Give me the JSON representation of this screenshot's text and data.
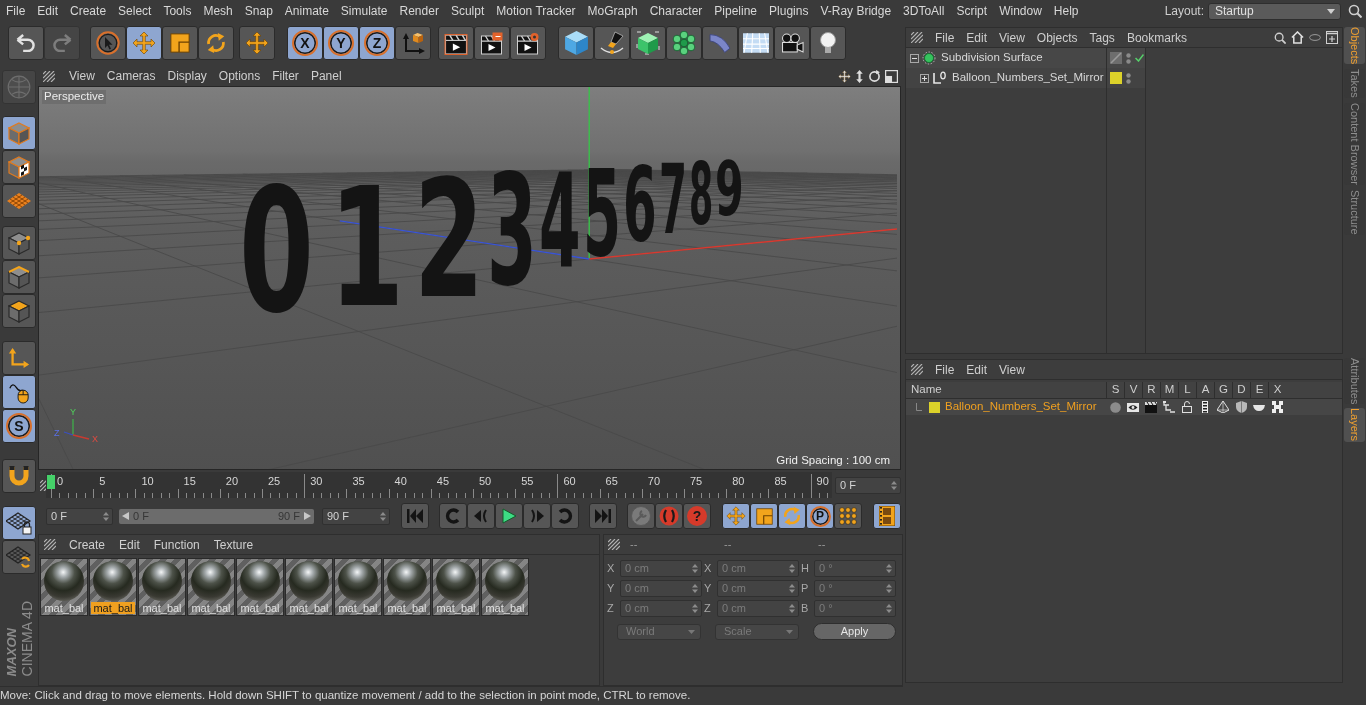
{
  "menu": [
    "File",
    "Edit",
    "Create",
    "Select",
    "Tools",
    "Mesh",
    "Snap",
    "Animate",
    "Simulate",
    "Render",
    "Sculpt",
    "Motion Tracker",
    "MoGraph",
    "Character",
    "Pipeline",
    "Plugins",
    "V-Ray Bridge",
    "3DToAll",
    "Script",
    "Window",
    "Help"
  ],
  "layout": {
    "label": "Layout:",
    "value": "Startup"
  },
  "toolbar": {
    "history": [
      {
        "disabled": false
      },
      {
        "disabled": true
      }
    ],
    "tools": [
      {
        "selected": false
      },
      {
        "selected": true
      },
      {
        "selected": false
      },
      {
        "selected": false
      }
    ],
    "axis_locks": [
      {
        "label": "X",
        "selected": true
      },
      {
        "label": "Y",
        "selected": true
      },
      {
        "label": "Z",
        "selected": true
      }
    ],
    "coordinate_system": {
      "selected": false
    }
  },
  "left_toolbar": {
    "top": {
      "disabled": true
    },
    "modes": [
      {
        "selected": true
      },
      {
        "selected": false
      },
      {
        "selected": false
      }
    ],
    "components": [
      {
        "selected": false
      },
      {
        "selected": false
      },
      {
        "selected": false
      }
    ],
    "tools": [
      {
        "selected": false
      },
      {
        "selected": true
      },
      {
        "label": "S",
        "selected": true
      }
    ],
    "workplane": [
      {
        "selected": true
      },
      {
        "selected": false
      }
    ]
  },
  "logo": {
    "brand": "MAXON",
    "product": "CINEMA 4D"
  },
  "viewport": {
    "menu": [
      "View",
      "Cameras",
      "Display",
      "Options",
      "Filter",
      "Panel"
    ],
    "camera": "Perspective",
    "model_digits": [
      "0",
      "1",
      "2",
      "3",
      "4",
      "5",
      "6",
      "7",
      "8",
      "9"
    ],
    "axis_labels": [
      "Y",
      "Z",
      "X"
    ],
    "grid_spacing": "Grid Spacing : 100 cm"
  },
  "timeline": {
    "ticks": [
      "0",
      "5",
      "10",
      "15",
      "20",
      "25",
      "30",
      "35",
      "40",
      "45",
      "50",
      "55",
      "60",
      "65",
      "70",
      "75",
      "80",
      "85",
      "90"
    ],
    "level": 0,
    "current_frame": "0 F"
  },
  "transport": {
    "start": "0 F",
    "range": {
      "start": "0 F",
      "end": "90 F",
      "level": 1
    },
    "end": "90 F",
    "help_label": "?",
    "key_filters": [
      {
        "selected": true
      },
      {
        "selected": true
      },
      {
        "selected": true
      },
      {
        "label": "P",
        "selected": true
      },
      {
        "selected": false
      }
    ],
    "timeline_button": {
      "selected": true
    }
  },
  "materials": {
    "menu": [
      "Create",
      "Edit",
      "Function",
      "Texture"
    ],
    "items": [
      {
        "name": "mat_bal",
        "selected": false
      },
      {
        "name": "mat_bal",
        "selected": true
      },
      {
        "name": "mat_bal",
        "selected": false
      },
      {
        "name": "mat_bal",
        "selected": false
      },
      {
        "name": "mat_bal",
        "selected": false
      },
      {
        "name": "mat_bal",
        "selected": false
      },
      {
        "name": "mat_bal",
        "selected": false
      },
      {
        "name": "mat_bal",
        "selected": false
      },
      {
        "name": "mat_bal",
        "selected": false
      },
      {
        "name": "mat_bal",
        "selected": false
      }
    ]
  },
  "coordinates": {
    "headers": [
      "--",
      "--",
      "--"
    ],
    "disabled": true,
    "rows": [
      [
        {
          "axis": "X",
          "value": "0 cm"
        },
        {
          "axis": "X",
          "value": "0 cm"
        },
        {
          "axis": "H",
          "value": "0 °"
        }
      ],
      [
        {
          "axis": "Y",
          "value": "0 cm"
        },
        {
          "axis": "Y",
          "value": "0 cm"
        },
        {
          "axis": "P",
          "value": "0 °"
        }
      ],
      [
        {
          "axis": "Z",
          "value": "0 cm"
        },
        {
          "axis": "Z",
          "value": "0 cm"
        },
        {
          "axis": "B",
          "value": "0 °"
        }
      ]
    ],
    "dropdowns": [
      "World",
      "Scale"
    ],
    "apply": "Apply"
  },
  "status_bar": "Move: Click and drag to move elements. Hold down SHIFT to quantize movement / add to the selection in point mode, CTRL to remove.",
  "objects": {
    "menu": [
      "File",
      "Edit",
      "View",
      "Objects",
      "Tags",
      "Bookmarks"
    ],
    "tree": [
      {
        "name": "Subdivision Surface",
        "kind": "subdivision",
        "expanded": true,
        "enabled": true,
        "children": [
          {
            "name": "Balloon_Numbers_Set_Mirror",
            "kind": "null",
            "expanded": false,
            "color": "#dcd22a"
          }
        ]
      }
    ]
  },
  "layers": {
    "menu": [
      "File",
      "Edit",
      "View"
    ],
    "columns": [
      "Name",
      "S",
      "V",
      "R",
      "M",
      "L",
      "A",
      "G",
      "D",
      "E",
      "X"
    ],
    "rows": [
      {
        "name": "Balloon_Numbers_Set_Mirror",
        "color": "#dcd22a",
        "selected": true
      }
    ]
  },
  "side_tabs": {
    "upper": [
      {
        "label": "Objects",
        "selected": true
      },
      {
        "label": "Takes",
        "selected": false
      },
      {
        "label": "Content Browser",
        "selected": false
      },
      {
        "label": "Structure",
        "selected": false
      }
    ],
    "lower": [
      {
        "label": "Attributes",
        "selected": false
      },
      {
        "label": "Layers",
        "selected": true
      }
    ]
  }
}
